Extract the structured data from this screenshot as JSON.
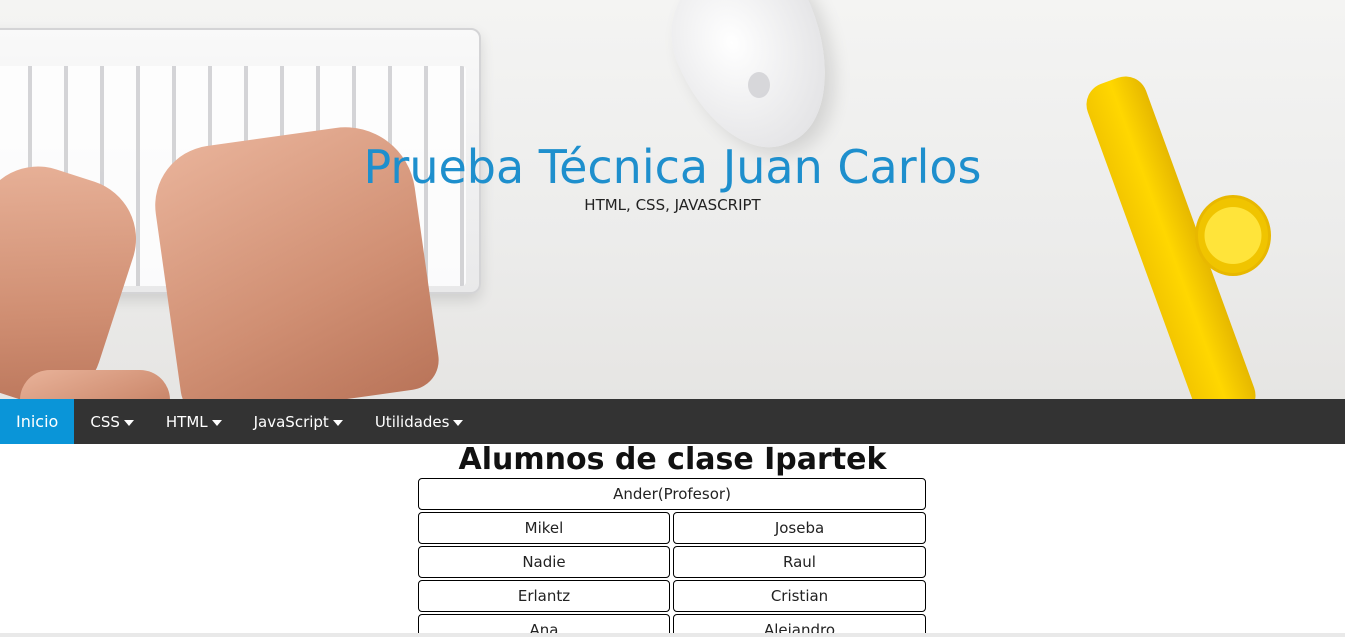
{
  "hero": {
    "title": "Prueba Técnica Juan Carlos",
    "subtitle": "HTML, CSS, JAVASCRIPT"
  },
  "nav": {
    "items": [
      {
        "label": "Inicio",
        "active": true,
        "dropdown": false
      },
      {
        "label": "CSS",
        "active": false,
        "dropdown": true
      },
      {
        "label": "HTML",
        "active": false,
        "dropdown": true
      },
      {
        "label": "JavaScript",
        "active": false,
        "dropdown": true
      },
      {
        "label": "Utilidades",
        "active": false,
        "dropdown": true
      }
    ]
  },
  "main": {
    "title": "Alumnos de clase Ipartek",
    "teacher": "Ander(Profesor)",
    "rows": [
      [
        "Mikel",
        "Joseba"
      ],
      [
        "Nadie",
        "Raul"
      ],
      [
        "Erlantz",
        "Cristian"
      ],
      [
        "Ana",
        "Alejandro"
      ]
    ]
  },
  "colors": {
    "accent": "#0a95d8",
    "title_blue": "#1e8fcd",
    "nav_bg": "#333333"
  }
}
